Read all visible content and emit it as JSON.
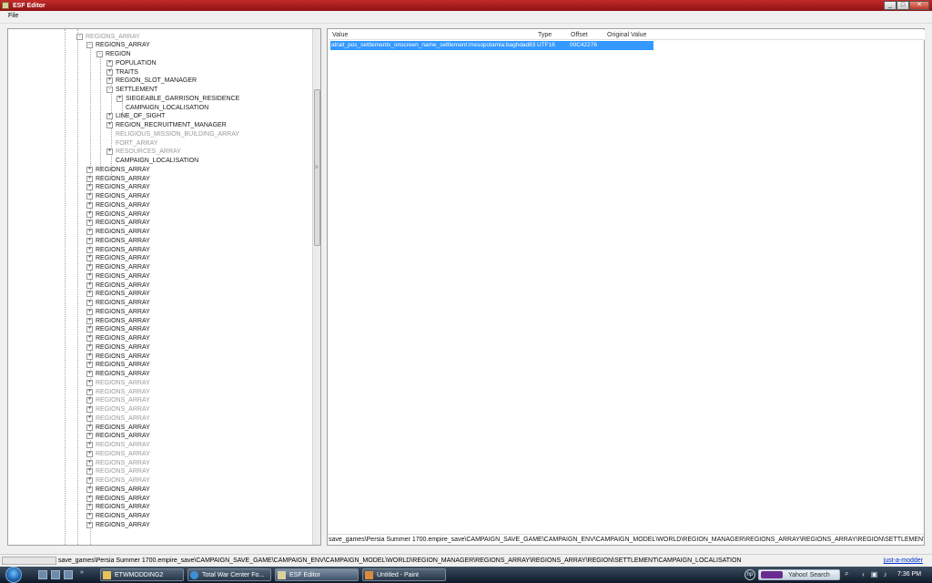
{
  "window": {
    "title": "ESF Editor",
    "buttons": {
      "minimize": "_",
      "maximize": "□",
      "close": "✕"
    }
  },
  "menu": {
    "file": "File"
  },
  "tree": {
    "nodes": [
      {
        "label": "REGIONS_ARRAY",
        "level": 0,
        "expander": "-",
        "dim": true
      },
      {
        "label": "REGIONS_ARRAY",
        "level": 1,
        "expander": "-",
        "dim": false
      },
      {
        "label": "REGION",
        "level": 2,
        "expander": "-",
        "dim": false
      },
      {
        "label": "POPULATION",
        "level": 3,
        "expander": "+",
        "dim": false
      },
      {
        "label": "TRAITS",
        "level": 3,
        "expander": "+",
        "dim": false
      },
      {
        "label": "REGION_SLOT_MANAGER",
        "level": 3,
        "expander": "+",
        "dim": false
      },
      {
        "label": "SETTLEMENT",
        "level": 3,
        "expander": "-",
        "dim": false
      },
      {
        "label": "SIEGEABLE_GARRISON_RESIDENCE",
        "level": 4,
        "expander": "+",
        "dim": false
      },
      {
        "label": "CAMPAIGN_LOCALISATION",
        "level": 4,
        "expander": "",
        "dim": false
      },
      {
        "label": "LINE_OF_SIGHT",
        "level": 3,
        "expander": "+",
        "dim": false
      },
      {
        "label": "REGION_RECRUITMENT_MANAGER",
        "level": 3,
        "expander": "+",
        "dim": false
      },
      {
        "label": "RELIGIOUS_MISSION_BUILDING_ARRAY",
        "level": 3,
        "expander": "",
        "dim": true
      },
      {
        "label": "FORT_ARRAY",
        "level": 3,
        "expander": "",
        "dim": true
      },
      {
        "label": "RESOURCES_ARRAY",
        "level": 3,
        "expander": "+",
        "dim": true
      },
      {
        "label": "CAMPAIGN_LOCALISATION",
        "level": 3,
        "expander": "",
        "dim": false
      },
      {
        "label": "REGIONS_ARRAY",
        "level": 1,
        "expander": "+",
        "dim": false
      },
      {
        "label": "REGIONS_ARRAY",
        "level": 1,
        "expander": "+",
        "dim": false
      },
      {
        "label": "REGIONS_ARRAY",
        "level": 1,
        "expander": "+",
        "dim": false
      },
      {
        "label": "REGIONS_ARRAY",
        "level": 1,
        "expander": "+",
        "dim": false
      },
      {
        "label": "REGIONS_ARRAY",
        "level": 1,
        "expander": "+",
        "dim": false
      },
      {
        "label": "REGIONS_ARRAY",
        "level": 1,
        "expander": "+",
        "dim": false
      },
      {
        "label": "REGIONS_ARRAY",
        "level": 1,
        "expander": "+",
        "dim": false
      },
      {
        "label": "REGIONS_ARRAY",
        "level": 1,
        "expander": "+",
        "dim": false
      },
      {
        "label": "REGIONS_ARRAY",
        "level": 1,
        "expander": "+",
        "dim": false
      },
      {
        "label": "REGIONS_ARRAY",
        "level": 1,
        "expander": "+",
        "dim": false
      },
      {
        "label": "REGIONS_ARRAY",
        "level": 1,
        "expander": "+",
        "dim": false
      },
      {
        "label": "REGIONS_ARRAY",
        "level": 1,
        "expander": "+",
        "dim": false
      },
      {
        "label": "REGIONS_ARRAY",
        "level": 1,
        "expander": "+",
        "dim": false
      },
      {
        "label": "REGIONS_ARRAY",
        "level": 1,
        "expander": "+",
        "dim": false
      },
      {
        "label": "REGIONS_ARRAY",
        "level": 1,
        "expander": "+",
        "dim": false
      },
      {
        "label": "REGIONS_ARRAY",
        "level": 1,
        "expander": "+",
        "dim": false
      },
      {
        "label": "REGIONS_ARRAY",
        "level": 1,
        "expander": "+",
        "dim": false
      },
      {
        "label": "REGIONS_ARRAY",
        "level": 1,
        "expander": "+",
        "dim": false
      },
      {
        "label": "REGIONS_ARRAY",
        "level": 1,
        "expander": "+",
        "dim": false
      },
      {
        "label": "REGIONS_ARRAY",
        "level": 1,
        "expander": "+",
        "dim": false
      },
      {
        "label": "REGIONS_ARRAY",
        "level": 1,
        "expander": "+",
        "dim": false
      },
      {
        "label": "REGIONS_ARRAY",
        "level": 1,
        "expander": "+",
        "dim": false
      },
      {
        "label": "REGIONS_ARRAY",
        "level": 1,
        "expander": "+",
        "dim": false
      },
      {
        "label": "REGIONS_ARRAY",
        "level": 1,
        "expander": "+",
        "dim": false
      },
      {
        "label": "REGIONS_ARRAY",
        "level": 1,
        "expander": "+",
        "dim": true
      },
      {
        "label": "REGIONS_ARRAY",
        "level": 1,
        "expander": "+",
        "dim": true
      },
      {
        "label": "REGIONS_ARRAY",
        "level": 1,
        "expander": "+",
        "dim": true
      },
      {
        "label": "REGIONS_ARRAY",
        "level": 1,
        "expander": "+",
        "dim": true
      },
      {
        "label": "REGIONS_ARRAY",
        "level": 1,
        "expander": "+",
        "dim": true
      },
      {
        "label": "REGIONS_ARRAY",
        "level": 1,
        "expander": "+",
        "dim": false
      },
      {
        "label": "REGIONS_ARRAY",
        "level": 1,
        "expander": "+",
        "dim": false
      },
      {
        "label": "REGIONS_ARRAY",
        "level": 1,
        "expander": "+",
        "dim": true
      },
      {
        "label": "REGIONS_ARRAY",
        "level": 1,
        "expander": "+",
        "dim": true
      },
      {
        "label": "REGIONS_ARRAY",
        "level": 1,
        "expander": "+",
        "dim": true
      },
      {
        "label": "REGIONS_ARRAY",
        "level": 1,
        "expander": "+",
        "dim": true
      },
      {
        "label": "REGIONS_ARRAY",
        "level": 1,
        "expander": "+",
        "dim": true
      },
      {
        "label": "REGIONS_ARRAY",
        "level": 1,
        "expander": "+",
        "dim": false
      },
      {
        "label": "REGIONS_ARRAY",
        "level": 1,
        "expander": "+",
        "dim": false
      },
      {
        "label": "REGIONS_ARRAY",
        "level": 1,
        "expander": "+",
        "dim": false
      },
      {
        "label": "REGIONS_ARRAY",
        "level": 1,
        "expander": "+",
        "dim": false
      },
      {
        "label": "REGIONS_ARRAY",
        "level": 1,
        "expander": "+",
        "dim": false
      }
    ]
  },
  "grid": {
    "headers": {
      "value": "Value",
      "type": "Type",
      "offset": "Offset",
      "original": "Original Value"
    },
    "rows": [
      {
        "value": "atrait_pos_settlements_onscreen_name_settlement:mesopotamia:baghdad83",
        "type": "UTF16",
        "offset": "00C42276",
        "original": ""
      }
    ],
    "selection_color": "#3399ff"
  },
  "path_box": "save_games\\Persia Summer 1700.empire_save\\CAMPAIGN_SAVE_GAME\\CAMPAIGN_ENV\\CAMPAIGN_MODEL\\WORLD\\REGION_MANAGER\\REGIONS_ARRAY\\REGIONS_ARRAY\\REGION\\SETTLEMENT\\CAMPAIGN_LOCALISATION",
  "status": {
    "text": "save_games\\Persia Summer 1700.empire_save\\CAMPAIGN_SAVE_GAME\\CAMPAIGN_ENV\\CAMPAIGN_MODEL\\WORLD\\REGION_MANAGER\\REGIONS_ARRAY\\REGIONS_ARRAY\\REGION\\SETTLEMENT\\CAMPAIGN_LOCALISATION",
    "author": "just-a-modder"
  },
  "taskbar": {
    "tasks": [
      {
        "label": "ETWMODDING2",
        "icon": "folder-icon",
        "active": false
      },
      {
        "label": "Total War Center Fo...",
        "icon": "ie-icon",
        "active": false
      },
      {
        "label": "ESF Editor",
        "icon": "app-icon",
        "active": true
      },
      {
        "label": "Untitled - Paint",
        "icon": "paint-icon",
        "active": false
      }
    ],
    "search_text": "Yahoo! Search",
    "clock": "7:36 PM"
  }
}
